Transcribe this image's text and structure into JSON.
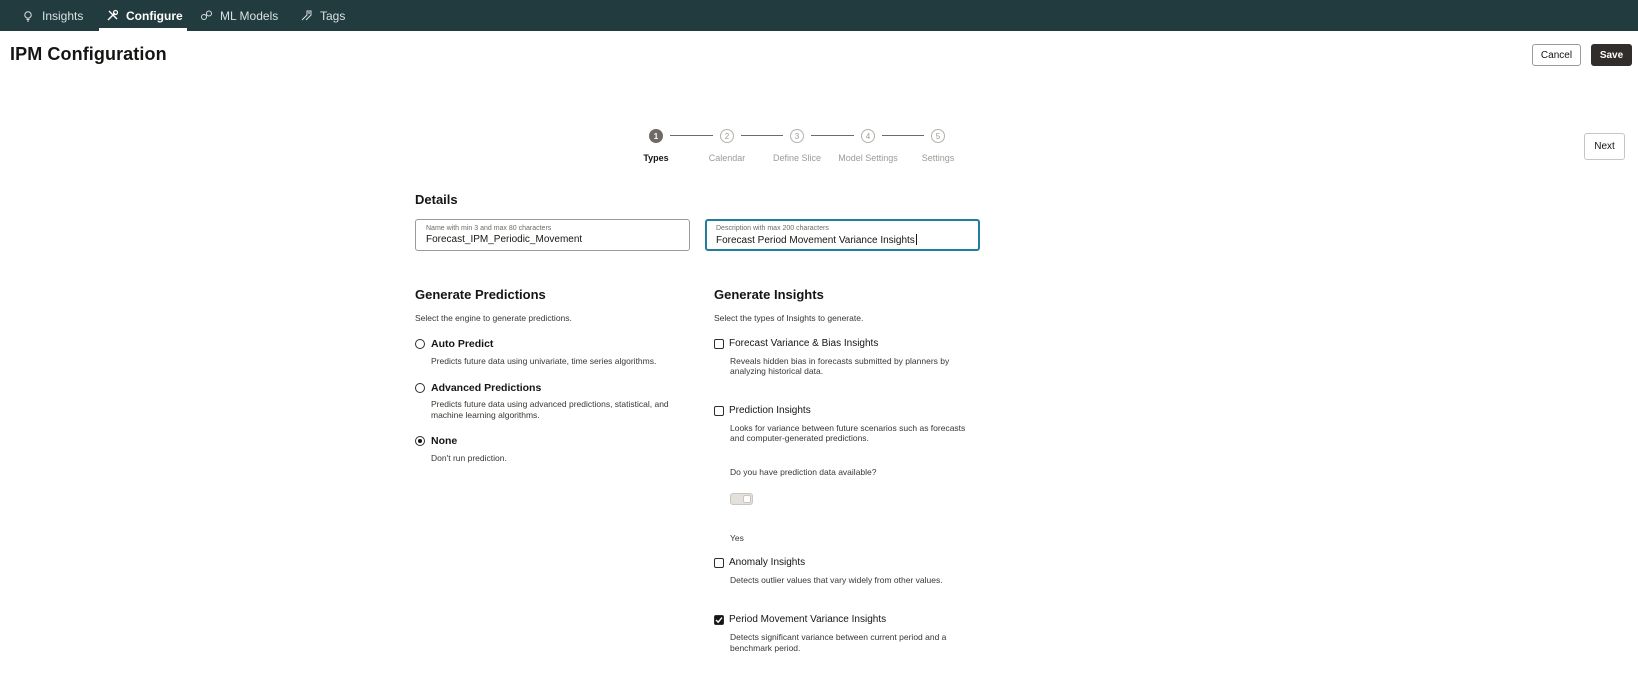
{
  "nav": {
    "tabs": [
      {
        "label": "Insights",
        "icon": "lightbulb-icon"
      },
      {
        "label": "Configure",
        "icon": "tools-icon",
        "active": true
      },
      {
        "label": "ML Models",
        "icon": "ml-models-icon"
      },
      {
        "label": "Tags",
        "icon": "tag-icon"
      }
    ]
  },
  "header": {
    "title": "IPM Configuration",
    "cancel_label": "Cancel",
    "save_label": "Save",
    "next_label": "Next"
  },
  "stepper": {
    "current": 1,
    "steps": [
      {
        "number": "1",
        "label": "Types"
      },
      {
        "number": "2",
        "label": "Calendar"
      },
      {
        "number": "3",
        "label": "Define Slice"
      },
      {
        "number": "4",
        "label": "Model Settings"
      },
      {
        "number": "5",
        "label": "Settings"
      }
    ]
  },
  "details": {
    "title": "Details",
    "name_field": {
      "label": "Name with min 3 and max 80 characters",
      "value": "Forecast_IPM_Periodic_Movement"
    },
    "description_field": {
      "label": "Description with max 200 characters",
      "value": "Forecast Period Movement Variance Insights"
    }
  },
  "predictions": {
    "title": "Generate Predictions",
    "subtitle": "Select the engine to generate predictions.",
    "options": [
      {
        "label": "Auto Predict",
        "desc1": "Predicts future data using univariate, time series algorithms.",
        "desc2": "",
        "selected": false
      },
      {
        "label": "Advanced Predictions",
        "desc1": "Predicts future data using advanced predictions, statistical, and",
        "desc2": "machine learning algorithms.",
        "selected": false
      },
      {
        "label": "None",
        "desc1": "Don't run prediction.",
        "desc2": "",
        "selected": true
      }
    ]
  },
  "insights": {
    "title": "Generate Insights",
    "subtitle": "Select the types of Insights to generate.",
    "options": [
      {
        "label": "Forecast Variance & Bias Insights",
        "desc1": "Reveals hidden bias in forecasts submitted by planners by",
        "desc2": "analyzing historical data.",
        "checked": false
      },
      {
        "label": "Prediction Insights",
        "desc1": "Looks for variance between future scenarios such as forecasts",
        "desc2": "and computer-generated predictions.",
        "checked": false
      },
      {
        "label": "Anomaly Insights",
        "desc1": "Detects outlier values that vary widely from other values.",
        "desc2": "",
        "checked": false
      },
      {
        "label": "Period Movement Variance Insights",
        "desc1": "Detects significant variance between current period and a",
        "desc2": "benchmark period.",
        "checked": true
      }
    ],
    "prediction_data_question": "Do you have prediction data available?",
    "prediction_data_toggle_label": "Yes",
    "prediction_data_toggle_on": false
  }
}
